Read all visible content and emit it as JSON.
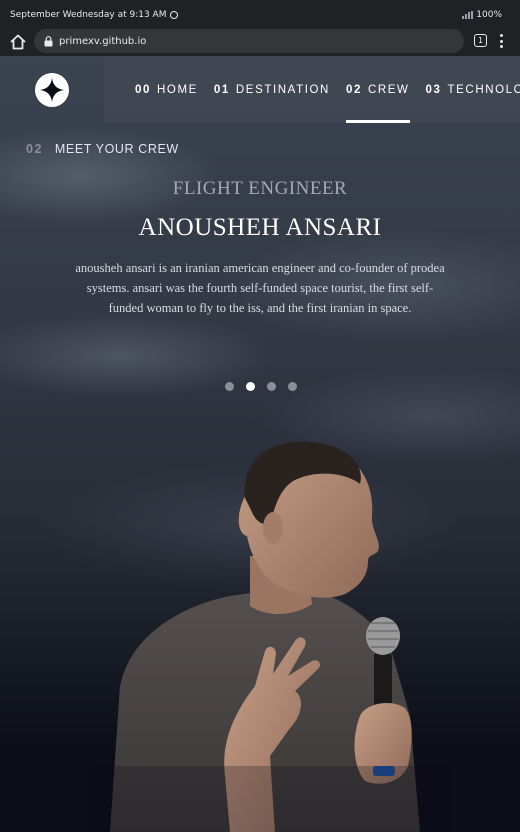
{
  "status_bar": {
    "time_text": "September Wednesday at 9:13 AM",
    "battery": "100%"
  },
  "browser": {
    "url": "primexv.github.io",
    "tab_count": "1"
  },
  "nav": {
    "items": [
      {
        "num": "00",
        "label": "HOME",
        "active": false
      },
      {
        "num": "01",
        "label": "DESTINATION",
        "active": false
      },
      {
        "num": "02",
        "label": "CREW",
        "active": true
      },
      {
        "num": "03",
        "label": "TECHNOLOGY",
        "active": false
      }
    ]
  },
  "section": {
    "num": "02",
    "title": "MEET YOUR CREW"
  },
  "crew": {
    "role": "FLIGHT ENGINEER",
    "name": "ANOUSHEH ANSARI",
    "bio": "anousheh ansari is an iranian american engineer and co-founder of prodea systems. ansari was the fourth self-funded space tourist, the first self-funded woman to fly to the iss, and the first iranian in space."
  },
  "carousel": {
    "count": 4,
    "active_index": 1
  },
  "colors": {
    "background": "#0b0d17",
    "accent": "#ffffff",
    "muted": "#a5a9b3"
  },
  "icons": [
    "home-icon",
    "lock-icon",
    "tabs-icon",
    "more-vert-icon",
    "star-logo-icon",
    "notification-icon",
    "signal-icon"
  ]
}
